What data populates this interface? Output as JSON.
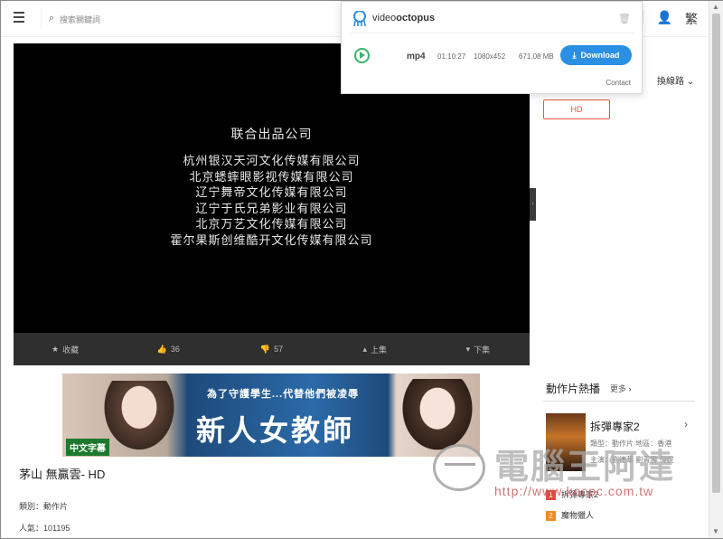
{
  "search": {
    "placeholder": "搜索關鍵詞"
  },
  "top_icons": {
    "trend": "📈",
    "user": "👤",
    "lang": "繁"
  },
  "video": {
    "credits_head": "联合出品公司",
    "credits": [
      "杭州银汉天河文化传媒有限公司",
      "北京蟋蟀眼影视传媒有限公司",
      "辽宁舞帝文化传媒有限公司",
      "辽宁于氏兄弟影业有限公司",
      "北京万艺文化传媒有限公司",
      "霍尔果斯创维酷开文化传媒有限公司"
    ]
  },
  "controls": {
    "favorite": "收藏",
    "likes": "36",
    "dislikes": "57",
    "prev": "上集",
    "next": "下集"
  },
  "banner": {
    "subtitle": "為了守護學生...代替他們被凌辱",
    "title": "新人女教師",
    "tag": "中文字幕"
  },
  "movie": {
    "title": "茅山  無贏雲- HD",
    "category": "類別：動作片",
    "popularity": "人氣：101195"
  },
  "sidebar": {
    "route": "換線路 ⌄",
    "hd": "HD",
    "hot_title": "動作片熱播",
    "hot_more": "更多 ›",
    "hot_item": {
      "name": "拆彈專家2",
      "meta1": "類型：動作片  地區：香港",
      "meta2": "主演：劉德華 劉青雲 倪妮"
    },
    "ranks": [
      {
        "num": "1",
        "name": "拆彈專家2",
        "color": "#e04b3c"
      },
      {
        "num": "2",
        "name": "魔物獵人",
        "color": "#f08a24"
      }
    ]
  },
  "watermark": {
    "text": "電腦王阿達",
    "url": "http://www.kocpc.com.tw"
  },
  "videooctopus": {
    "brand_light": "video",
    "brand_bold": "octopus",
    "format": "mp4",
    "duration": "01:10:27",
    "resolution": "1080x452",
    "size": "671.08 MB",
    "download": "Download",
    "contact": "Contact"
  }
}
